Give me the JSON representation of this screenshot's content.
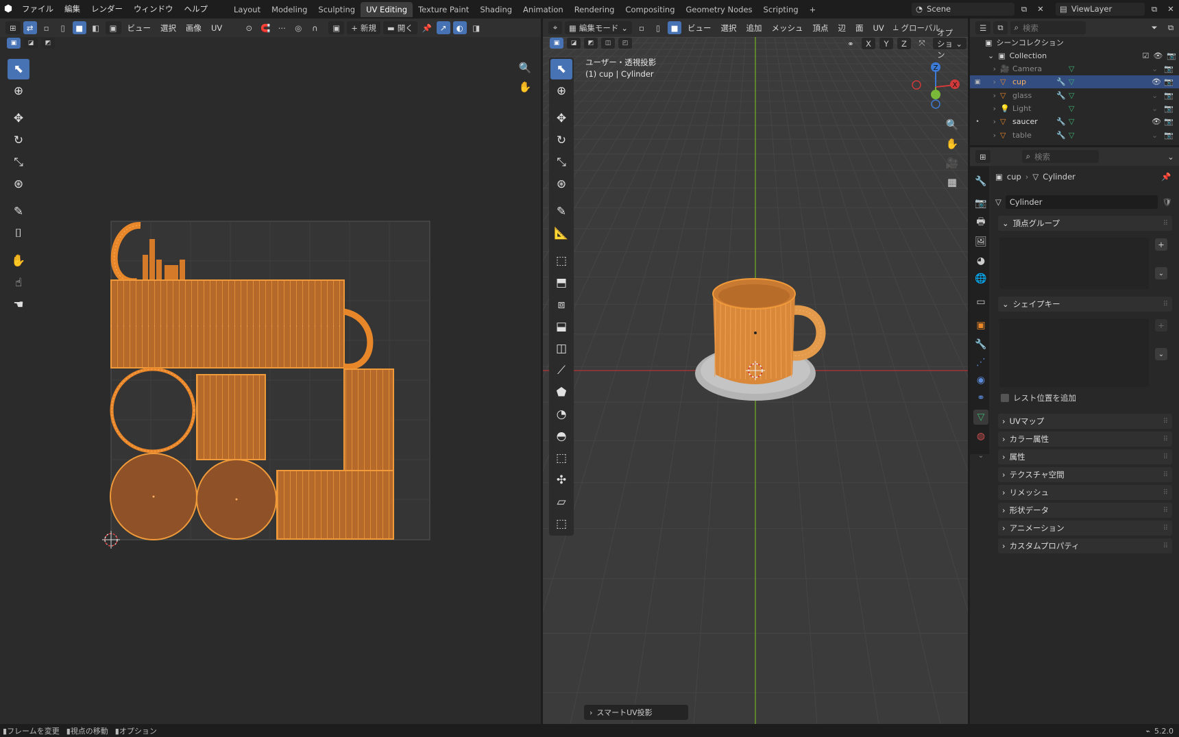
{
  "topbar": {
    "menus": [
      "ファイル",
      "編集",
      "レンダー",
      "ウィンドウ",
      "ヘルプ"
    ],
    "workspaces": [
      "Layout",
      "Modeling",
      "Sculpting",
      "UV Editing",
      "Texture Paint",
      "Shading",
      "Animation",
      "Rendering",
      "Compositing",
      "Geometry Nodes",
      "Scripting"
    ],
    "active_workspace": "UV Editing",
    "add_tab": "+",
    "scene": "Scene",
    "view_layer": "ViewLayer"
  },
  "uv_editor": {
    "menus": [
      "ビュー",
      "選択",
      "画像",
      "UV"
    ],
    "new_label": "新規",
    "open_label": "開く"
  },
  "viewport": {
    "mode": "編集モード",
    "menus": [
      "ビュー",
      "選択",
      "追加",
      "メッシュ",
      "頂点",
      "辺",
      "面",
      "UV"
    ],
    "orientation": "グローバル",
    "options": "オプション",
    "axes": [
      "X",
      "Y",
      "Z"
    ],
    "view_name": "ユーザー・透視投影",
    "object_info": "(1) cup | Cylinder",
    "operator_panel": "スマートUV投影",
    "gizmo": {
      "x": "X",
      "y": "Y",
      "z": "Z"
    }
  },
  "outliner": {
    "search_placeholder": "検索",
    "root": "シーンコレクション",
    "collection": "Collection",
    "items": [
      {
        "name": "Camera",
        "selected": false,
        "dim": true
      },
      {
        "name": "cup",
        "selected": true,
        "dim": false
      },
      {
        "name": "glass",
        "selected": false,
        "dim": true
      },
      {
        "name": "Light",
        "selected": false,
        "dim": true
      },
      {
        "name": "saucer",
        "selected": false,
        "dim": false
      },
      {
        "name": "table",
        "selected": false,
        "dim": true
      }
    ]
  },
  "properties": {
    "search_placeholder": "検索",
    "breadcrumb_object": "cup",
    "breadcrumb_data": "Cylinder",
    "mesh_name": "Cylinder",
    "vertex_groups": "頂点グループ",
    "shape_keys": "シェイプキー",
    "add_rest_position": "レスト位置を追加",
    "sections": [
      "UVマップ",
      "カラー属性",
      "属性",
      "テクスチャ空間",
      "リメッシュ",
      "形状データ",
      "アニメーション",
      "カスタムプロパティ"
    ]
  },
  "statusbar": {
    "items": [
      "フレームを変更",
      "視点の移動",
      "オプション"
    ],
    "version": "5.2.0"
  },
  "colors": {
    "accent": "#4772b3",
    "uv_orange": "#e8862a",
    "selected_row": "#334d80"
  }
}
